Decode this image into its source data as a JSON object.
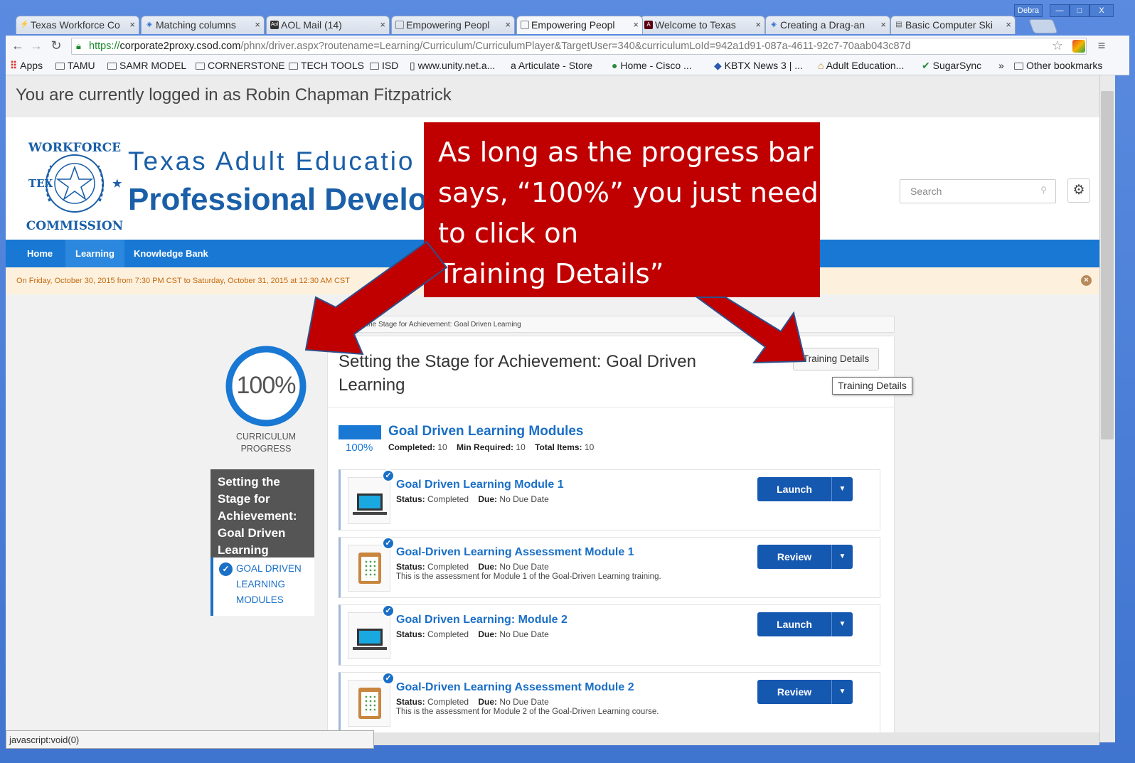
{
  "browser": {
    "tabs": [
      {
        "title": "Texas Workforce Co",
        "icon": "lightning-icon"
      },
      {
        "title": "Matching columns",
        "icon": "shield-icon"
      },
      {
        "title": "AOL Mail (14)",
        "icon": "aol-icon"
      },
      {
        "title": "Empowering Peopl",
        "icon": "page-icon"
      },
      {
        "title": "Empowering Peopl",
        "icon": "page-icon",
        "active": true
      },
      {
        "title": "Welcome to Texas",
        "icon": "tamu-icon"
      },
      {
        "title": "Creating a Drag-an",
        "icon": "shield-icon"
      },
      {
        "title": "Basic Computer Ski",
        "icon": "book-icon"
      }
    ],
    "user": "Debra",
    "url_scheme": "https://",
    "url_host": "corporate2proxy.csod.com",
    "url_path": "/phnx/driver.aspx?routename=Learning/Curriculum/CurriculumPlayer&TargetUser=340&curriculumLoId=942a1d91-087a-4611-92c7-70aab043c87d",
    "bookmarks": [
      "Apps",
      "TAMU",
      "SAMR MODEL",
      "CORNERSTONE",
      "TECH TOOLS",
      "ISD",
      "www.unity.net.a...",
      "Articulate - Store",
      "Home - Cisco ...",
      "KBTX News 3 | ...",
      "Adult Education...",
      "SugarSync",
      "»",
      "Other bookmarks"
    ],
    "status_text": "javascript:void(0)"
  },
  "page": {
    "login_text": "You are currently logged in as Robin Chapman Fitzpatrick",
    "seal_text": "TEXAS WORKFORCE COMMISSION",
    "org_line1": "Texas Adult Educatio",
    "org_line2": "Professional Develo",
    "search_placeholder": "Search",
    "nav": [
      "Home",
      "Learning",
      "Knowledge Bank"
    ],
    "notice": "On Friday, October 30, 2015 from 7:30 PM CST to Saturday, October 31, 2015 at 12:30 AM CST"
  },
  "curriculum": {
    "progress_pct": "100%",
    "progress_label_1": "CURRICULUM",
    "progress_label_2": "PROGRESS",
    "progress_value": 1.0,
    "side_title": "Setting the Stage for Achievement: Goal Driven Learning",
    "side_item_1": "GOAL DRIVEN",
    "side_item_2": "LEARNING",
    "side_item_3": "MODULES",
    "breadcrumb": "g the Stage for Achievement: Goal Driven Learning",
    "title_line1": "Setting the Stage for Achievement: Goal Driven",
    "title_line2": "Learning",
    "training_details_label": "Training Details",
    "tooltip": "Training Details",
    "section": {
      "title": "Goal Driven Learning Modules",
      "pct": "100%",
      "completed_label": "Completed:",
      "completed": "10",
      "min_label": "Min Required:",
      "min": "10",
      "total_label": "Total Items:",
      "total": "10"
    },
    "items": [
      {
        "title": "Goal Driven Learning Module 1",
        "status_label": "Status:",
        "status": "Completed",
        "due_label": "Due:",
        "due": "No Due Date",
        "desc": "",
        "action": "Launch",
        "icon": "laptop-icon"
      },
      {
        "title": "Goal-Driven Learning Assessment Module 1",
        "status_label": "Status:",
        "status": "Completed",
        "due_label": "Due:",
        "due": "No Due Date",
        "desc": "This is the assessment for Module 1 of the Goal-Driven Learning training.",
        "action": "Review",
        "icon": "clipboard-icon"
      },
      {
        "title": "Goal Driven Learning: Module 2",
        "status_label": "Status:",
        "status": "Completed",
        "due_label": "Due:",
        "due": "No Due Date",
        "desc": "",
        "action": "Launch",
        "icon": "laptop-icon"
      },
      {
        "title": "Goal-Driven Learning Assessment Module 2",
        "status_label": "Status:",
        "status": "Completed",
        "due_label": "Due:",
        "due": "No Due Date",
        "desc": "This is the assessment for Module 2 of the Goal-Driven Learning course.",
        "action": "Review",
        "icon": "clipboard-icon"
      }
    ]
  },
  "callout": {
    "line1": "As long as the progress bar",
    "line2": "says, “100%” you just need",
    "line3": "to click on",
    "line4": "Training Details”"
  },
  "colors": {
    "accent": "#1878d3",
    "callout": "#c00000",
    "button": "#1558b0"
  }
}
